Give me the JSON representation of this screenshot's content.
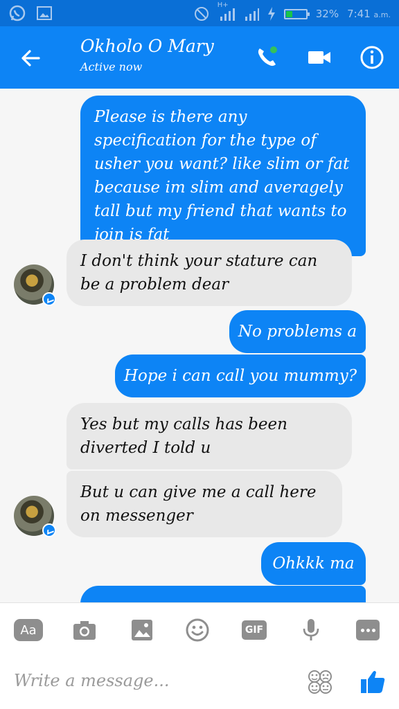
{
  "status_bar": {
    "signal_label": "H+",
    "battery_percent": "32%",
    "battery_level": 0.32,
    "time": "7:41",
    "ampm": "a.m."
  },
  "header": {
    "contact_name": "Okholo O Mary",
    "status": "Active now",
    "accent": "#0d84f5"
  },
  "messages": [
    {
      "direction": "out",
      "text": "Please is there any specification for the type of usher you want? like slim or fat because im slim and averagely tall but my friend that wants to join is fat"
    },
    {
      "direction": "in",
      "text": "I don't think your stature can be a problem dear"
    },
    {
      "direction": "out",
      "text": "No problems a"
    },
    {
      "direction": "out",
      "text": "Hope i can call you mummy?"
    },
    {
      "direction": "in",
      "text": "Yes but my calls has been diverted I told u"
    },
    {
      "direction": "in",
      "text": "But u can give me a call here on messenger"
    },
    {
      "direction": "out",
      "text": "Ohkkk ma"
    }
  ],
  "composer": {
    "aa_label": "Aa",
    "gif_label": "GIF",
    "placeholder": "Write a message..."
  }
}
